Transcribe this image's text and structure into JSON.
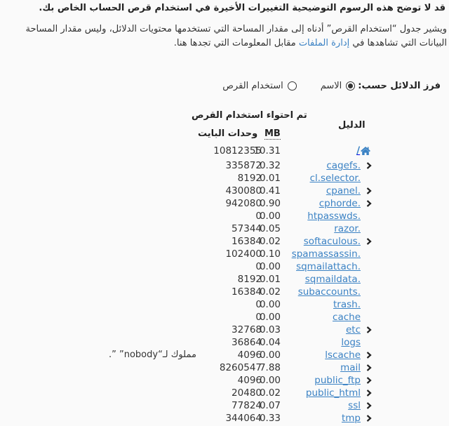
{
  "notice": {
    "title": "قد لا توضح هذه الرسوم التوضيحية التغييرات الأخيرة في استخدام قرص الحساب الخاص بك.",
    "desc_before": "ويشير جدول “استخدام القرص” أدناه إلى مقدار المساحة التي تستخدمها محتويات الدلائل، وليس مقدار المساحة البيانات التي تشاهدها في ",
    "desc_link": "إدارة الملفات",
    "desc_after": " مقابل المعلومات التي تجدها هنا."
  },
  "sort": {
    "label": "فرز الدلائل حسب:",
    "options": [
      {
        "label": "الاسم",
        "checked": true
      },
      {
        "label": "استخدام القرص",
        "checked": false
      }
    ]
  },
  "table": {
    "dir_header": "الدليل",
    "usage_header": "تم احتواء استخدام القرص",
    "mb_header": "MB",
    "bytes_header": "وحدات البايت",
    "home": {
      "icon": "home-icon",
      "slash": "/",
      "mb": "10.31",
      "bytes": "10812355"
    },
    "rows": [
      {
        "name": ".cagefs",
        "mb": "0.32",
        "bytes": "335872",
        "expandable": true
      },
      {
        "name": ".cl.selector",
        "mb": "0.01",
        "bytes": "8192",
        "expandable": false
      },
      {
        "name": ".cpanel",
        "mb": "0.41",
        "bytes": "430080",
        "expandable": true
      },
      {
        "name": ".cphorde",
        "mb": "0.90",
        "bytes": "942080",
        "expandable": true
      },
      {
        "name": ".htpasswds",
        "mb": "0.00",
        "bytes": "0",
        "expandable": false
      },
      {
        "name": ".razor",
        "mb": "0.05",
        "bytes": "57344",
        "expandable": false
      },
      {
        "name": ".softaculous",
        "mb": "0.02",
        "bytes": "16384",
        "expandable": true
      },
      {
        "name": ".spamassassin",
        "mb": "0.10",
        "bytes": "102400",
        "expandable": false
      },
      {
        "name": ".sqmailattach",
        "mb": "0.00",
        "bytes": "0",
        "expandable": false
      },
      {
        "name": ".sqmaildata",
        "mb": "0.01",
        "bytes": "8192",
        "expandable": false
      },
      {
        "name": ".subaccounts",
        "mb": "0.02",
        "bytes": "16384",
        "expandable": false
      },
      {
        "name": ".trash",
        "mb": "0.00",
        "bytes": "0",
        "expandable": false
      },
      {
        "name": "cache",
        "mb": "0.00",
        "bytes": "0",
        "expandable": false
      },
      {
        "name": "etc",
        "mb": "0.03",
        "bytes": "32768",
        "expandable": true
      },
      {
        "name": "logs",
        "mb": "0.04",
        "bytes": "36864",
        "expandable": false
      },
      {
        "name": "lscache",
        "mb": "0.00",
        "bytes": "4096",
        "expandable": true,
        "note": "مملوك لـ“nobody” ”."
      },
      {
        "name": "mail",
        "mb": "7.88",
        "bytes": "8260547",
        "expandable": true
      },
      {
        "name": "public_ftp",
        "mb": "0.00",
        "bytes": "4096",
        "expandable": true
      },
      {
        "name": "public_html",
        "mb": "0.02",
        "bytes": "20480",
        "expandable": true
      },
      {
        "name": "ssl",
        "mb": "0.07",
        "bytes": "77824",
        "expandable": true
      },
      {
        "name": "tmp",
        "mb": "0.33",
        "bytes": "344064",
        "expandable": true
      }
    ]
  },
  "colors": {
    "link": "#3b82c4",
    "text": "#333333",
    "background": "#fafafa"
  }
}
